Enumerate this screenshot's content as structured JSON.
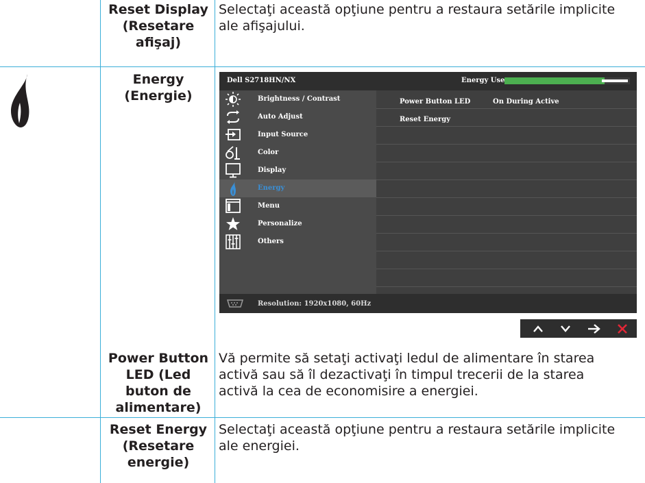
{
  "rows": {
    "reset_display": {
      "label_lines": [
        "Reset Display",
        "(Resetare",
        "afişaj)"
      ],
      "desc_lines": [
        "Selectaţi această opţiune pentru a restaura setările implicite",
        "ale afişajului."
      ]
    },
    "energy": {
      "label_lines": [
        "Energy",
        "(Energie)"
      ]
    },
    "power_button_led": {
      "label_lines": [
        "Power Button",
        "LED (Led",
        "buton de",
        "alimentare)"
      ],
      "desc_lines": [
        "Vă permite să setaţi activaţi ledul de alimentare în starea",
        "activă sau să îl dezactivaţi în timpul trecerii de la starea",
        "activă la cea de economisire a energiei."
      ]
    },
    "reset_energy": {
      "label_lines": [
        "Reset Energy",
        "(Resetare",
        "energie)"
      ],
      "desc_lines": [
        "Selectaţi această opţiune pentru a restaura setările implicite",
        "ale energiei."
      ]
    }
  },
  "osd": {
    "model": "Dell S2718HN/NX",
    "energy_use_label": "Energy Use",
    "energy_use_level": 0.8,
    "menu": [
      {
        "label": "Brightness / Contrast",
        "icon": "brightness-icon"
      },
      {
        "label": "Auto Adjust",
        "icon": "auto-adjust-icon"
      },
      {
        "label": "Input Source",
        "icon": "input-source-icon"
      },
      {
        "label": "Color",
        "icon": "color-icon"
      },
      {
        "label": "Display",
        "icon": "display-icon"
      },
      {
        "label": "Energy",
        "icon": "energy-icon"
      },
      {
        "label": "Menu",
        "icon": "menu-icon"
      },
      {
        "label": "Personalize",
        "icon": "star-icon"
      },
      {
        "label": "Others",
        "icon": "others-icon"
      }
    ],
    "active_item": "Energy",
    "submenu": {
      "power_button_led_label": "Power Button LED",
      "power_button_led_value": "On During Active",
      "reset_energy_label": "Reset Energy"
    },
    "footer": "Resolution: 1920x1080, 60Hz"
  },
  "nav_buttons": [
    "up-icon",
    "down-icon",
    "right-arrow-icon",
    "close-icon"
  ],
  "colors": {
    "rule": "#3aaed8",
    "osd_bg": "#4a4a4a",
    "active_text": "#3a8fd6",
    "close": "#e32636",
    "energy_bar": "#4caf50"
  }
}
